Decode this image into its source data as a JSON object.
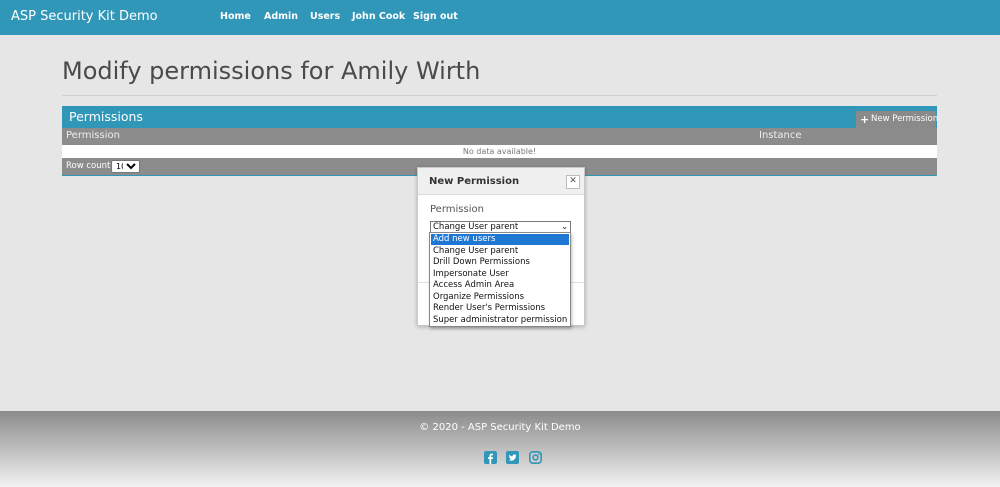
{
  "navbar": {
    "brand": "ASP Security Kit Demo",
    "links": [
      "Home",
      "Admin",
      "Users",
      "John Cook",
      "Sign out"
    ]
  },
  "page": {
    "title": "Modify permissions for Amily Wirth"
  },
  "panel": {
    "title": "Permissions",
    "new_button": "New Permission",
    "columns": [
      "Permission",
      "Instance"
    ],
    "empty_text": "No data available!",
    "row_count_label": "Row count:",
    "row_count_value": "10"
  },
  "modal": {
    "title": "New Permission",
    "close_icon": "close-icon",
    "field_label": "Permission",
    "selected_value": "Change User parent",
    "options": [
      "Add new users",
      "Change User parent",
      "Drill Down Permissions",
      "Impersonate User",
      "Access Admin Area",
      "Organize Permissions",
      "Render User's Permissions",
      "Super administrator permission"
    ],
    "highlighted_index": 0
  },
  "footer": {
    "copyright": "© 2020 - ASP Security Kit Demo",
    "social_icons": [
      "facebook-icon",
      "twitter-icon",
      "instagram-icon"
    ]
  },
  "colors": {
    "brand": "#3197b9",
    "highlight": "#1e77d3",
    "grid_gray": "#8c8c8c"
  }
}
